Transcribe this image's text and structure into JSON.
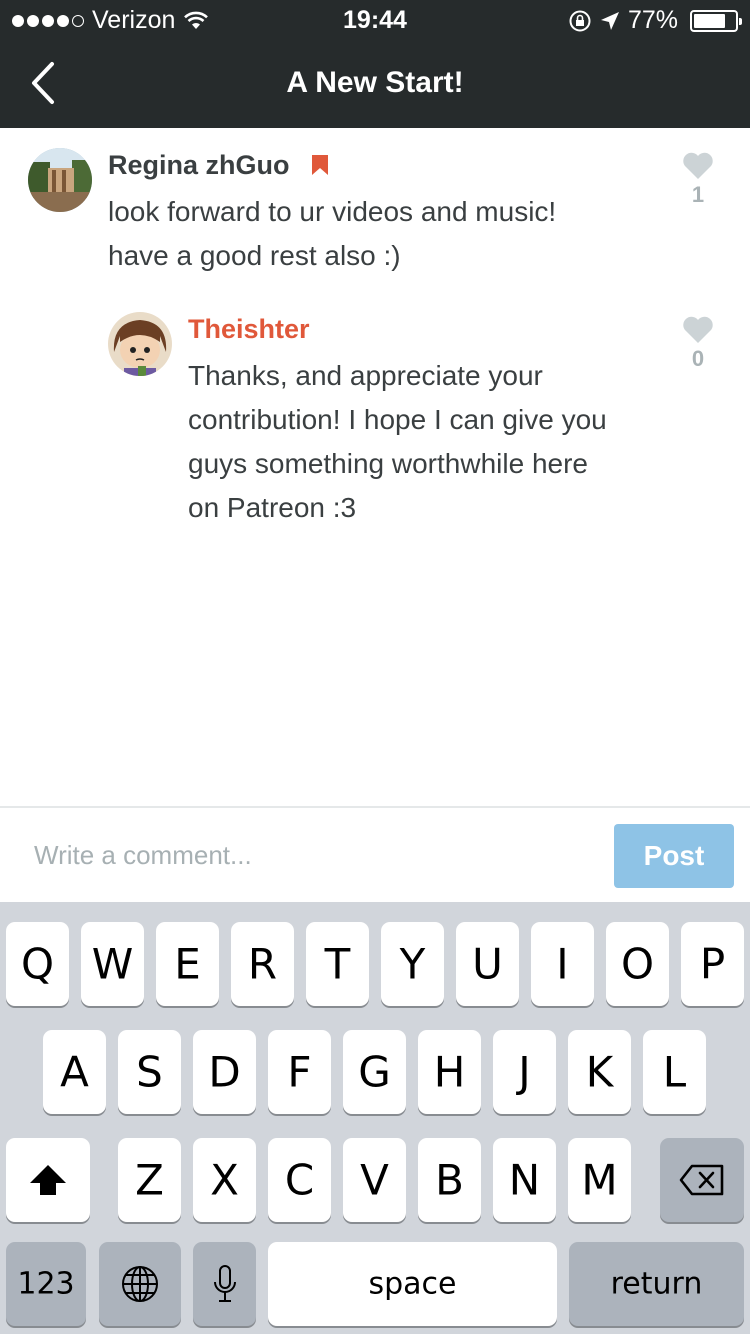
{
  "status_bar": {
    "carrier": "Verizon",
    "time": "19:44",
    "battery": "77%",
    "battery_level": 0.77
  },
  "nav": {
    "title": "A New Start!"
  },
  "comments": [
    {
      "author": "Regina zhGuo",
      "text_lines": [
        "look forward to ur videos and music!",
        "have a good rest also :)"
      ],
      "likes": "1",
      "author_color": "#3a3f41"
    },
    {
      "author": "Theishter",
      "text_lines": [
        "Thanks, and appreciate your",
        "contribution! I hope I can give you",
        "guys something worthwhile here",
        "on Patreon :3"
      ],
      "likes": "0",
      "author_color": "#e0583a"
    }
  ],
  "composer": {
    "placeholder": "Write a comment...",
    "post_label": "Post"
  },
  "keyboard": {
    "row1": [
      "Q",
      "W",
      "E",
      "R",
      "T",
      "Y",
      "U",
      "I",
      "O",
      "P"
    ],
    "row2": [
      "A",
      "S",
      "D",
      "F",
      "G",
      "H",
      "J",
      "K",
      "L"
    ],
    "row3": [
      "Z",
      "X",
      "C",
      "V",
      "B",
      "N",
      "M"
    ],
    "numbers_label": "123",
    "space_label": "space",
    "return_label": "return"
  },
  "icons": {
    "back": "chevron-left-icon",
    "bookmark": "bookmark-icon",
    "like": "heart-icon",
    "shift": "shift-icon",
    "delete": "backspace-icon",
    "globe": "globe-icon",
    "mic": "microphone-icon"
  }
}
